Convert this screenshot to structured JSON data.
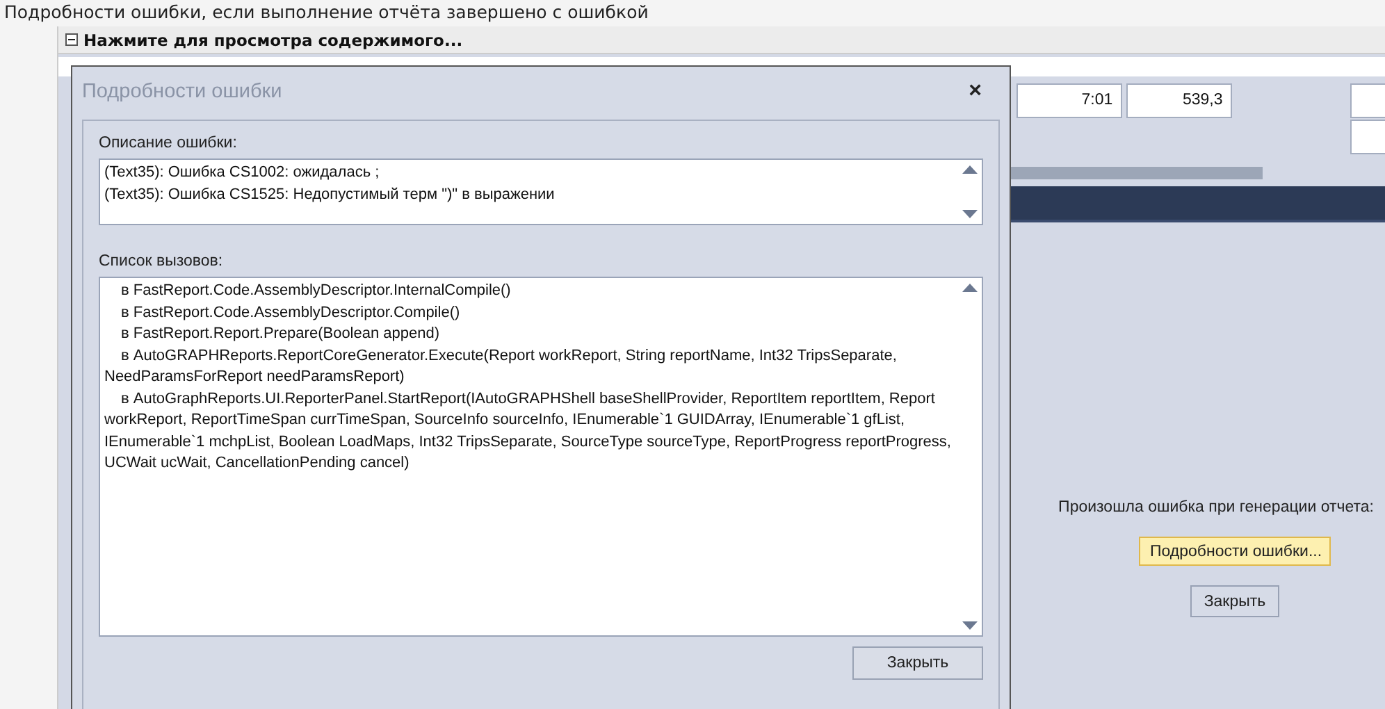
{
  "page_title": "Подробности ошибки, если выполнение отчёта завершено с ошибкой",
  "panel": {
    "header": "Нажмите для просмотра содержимого...",
    "expanded": true
  },
  "report_fields": [
    {
      "value": "7:01"
    },
    {
      "value": "539,3"
    }
  ],
  "error_panel": {
    "message": "Произошла ошибка при генерации отчета:",
    "buttons": [
      {
        "label": "Подробности ошибки...",
        "highlighted": true
      },
      {
        "label": "Закрыть",
        "highlighted": false
      }
    ]
  },
  "dialog": {
    "title": "Подробности ошибки",
    "close_glyph": "×",
    "description_label": "Описание ошибки:",
    "description_lines": [
      "(Text35): Ошибка CS1002: ожидалась ;",
      "(Text35): Ошибка CS1525: Недопустимый терм \")\" в выражении"
    ],
    "callstack_label": "Список вызовов:",
    "callstack": [
      "в FastReport.Code.AssemblyDescriptor.InternalCompile()",
      "в FastReport.Code.AssemblyDescriptor.Compile()",
      "в FastReport.Report.Prepare(Boolean append)",
      "в AutoGRAPHReports.ReportCoreGenerator.Execute(Report workReport, String reportName, Int32 TripsSeparate, NeedParamsForReport needParamsReport)",
      "в AutoGraphReports.UI.ReporterPanel.StartReport(IAutoGRAPHShell baseShellProvider, ReportItem reportItem, Report workReport, ReportTimeSpan currTimeSpan, SourceInfo sourceInfo, IEnumerable`1 GUIDArray, IEnumerable`1 gfList, IEnumerable`1 mchpList, Boolean LoadMaps, Int32 TripsSeparate, SourceType sourceType, ReportProgress reportProgress, UCWait ucWait, CancellationPending cancel)"
    ],
    "close_button": "Закрыть"
  }
}
